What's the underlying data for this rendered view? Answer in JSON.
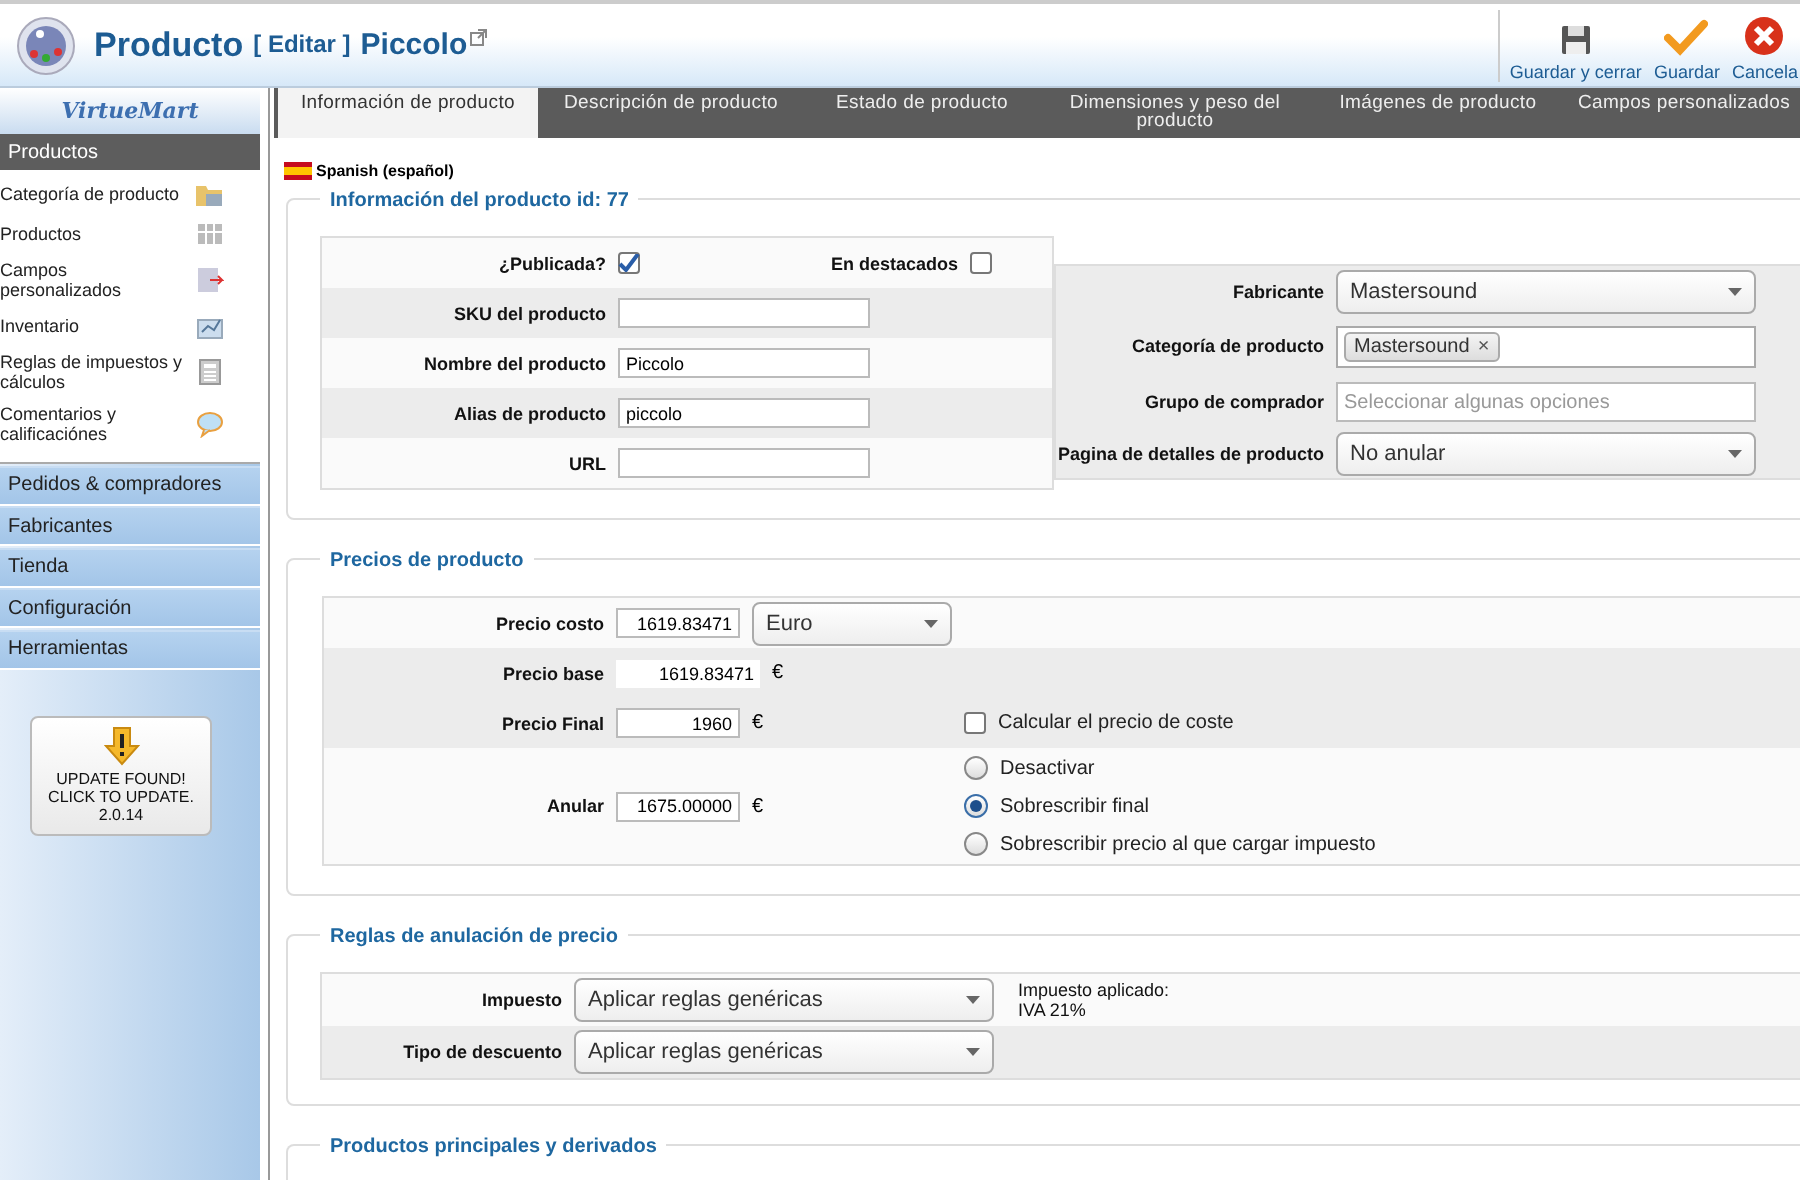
{
  "header": {
    "title": "Producto",
    "edit_label": "[ Editar ]",
    "product_name": "Piccolo"
  },
  "toolbar": [
    {
      "kind": "save-close",
      "label": "Guardar y cerrar"
    },
    {
      "kind": "save",
      "label": "Guardar"
    },
    {
      "kind": "cancel",
      "label": "Cancela"
    }
  ],
  "sidebar": {
    "logo": "VirtueMart",
    "section": "Productos",
    "items": [
      {
        "kind": "folder",
        "label": "Categoría de producto"
      },
      {
        "kind": "grid",
        "label": "Productos"
      },
      {
        "kind": "form",
        "label": "Campos personalizados"
      },
      {
        "kind": "chart",
        "label": "Inventario"
      },
      {
        "kind": "calculator",
        "label": "Reglas de impuestos y cálculos"
      },
      {
        "kind": "bubble",
        "label": "Comentarios y calificaciónes"
      }
    ],
    "groups": [
      "Pedidos & compradores",
      "Fabricantes",
      "Tienda",
      "Configuración",
      "Herramientas"
    ],
    "update_notice": [
      "UPDATE FOUND!",
      "CLICK TO UPDATE.",
      "2.0.14"
    ]
  },
  "tabs": [
    {
      "label": "Información de producto",
      "selected": true
    },
    {
      "label": "Descripción de producto",
      "selected": false
    },
    {
      "label": "Estado de producto",
      "selected": false
    },
    {
      "label": "Dimensiones y peso del producto",
      "selected": false
    },
    {
      "label": "Imágenes de producto",
      "selected": false
    },
    {
      "label": "Campos personalizados",
      "selected": false
    }
  ],
  "language": "Spanish (español)",
  "product_info": {
    "legend": "Información del producto id: 77",
    "published": {
      "label": "¿Publicada?",
      "checked": true
    },
    "featured": {
      "label": "En destacados",
      "checked": false
    },
    "fields": [
      {
        "label": "SKU del producto"
      },
      {
        "label": "Nombre del producto",
        "value": "Piccolo"
      },
      {
        "label": "Alias de producto",
        "value": "piccolo"
      },
      {
        "label": "URL"
      }
    ],
    "right_fields": [
      {
        "kind": "select",
        "label": "Fabricante",
        "value": "Mastersound"
      },
      {
        "kind": "tags",
        "label": "Categoría de producto",
        "tags": [
          "Mastersound"
        ],
        "remove_symbol": "×"
      },
      {
        "kind": "multiselect",
        "label": "Grupo de comprador",
        "placeholder": "Seleccionar algunas opciones"
      },
      {
        "kind": "select",
        "label": "Pagina de detalles de producto",
        "value": "No anular"
      }
    ]
  },
  "prices": {
    "legend": "Precios de producto",
    "cost": {
      "label": "Precio costo",
      "value": "1619.83471",
      "currency": "Euro"
    },
    "base": {
      "label": "Precio base",
      "value": "1619.83471",
      "symbol": "€"
    },
    "final": {
      "label": "Precio Final",
      "value": "1960",
      "symbol": "€",
      "calc_label": "Calcular el precio de coste",
      "calc_checked": false
    },
    "override": {
      "label": "Anular",
      "value": "1675.00000",
      "symbol": "€",
      "options": [
        {
          "label": "Desactivar",
          "selected": false
        },
        {
          "label": "Sobrescribir final",
          "selected": true
        },
        {
          "label": "Sobrescribir precio al que cargar impuesto",
          "selected": false
        }
      ]
    }
  },
  "rules": {
    "legend": "Reglas de anulación de precio",
    "rows": [
      {
        "label": "Impuesto",
        "value": "Aplicar reglas genéricas",
        "note": [
          "Impuesto aplicado:",
          "IVA 21%"
        ]
      },
      {
        "label": "Tipo de descuento",
        "value": "Aplicar reglas genéricas"
      }
    ]
  },
  "related": {
    "legend": "Productos principales y derivados"
  }
}
